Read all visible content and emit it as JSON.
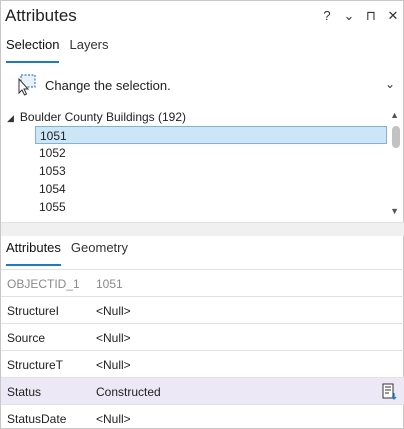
{
  "window": {
    "title": "Attributes",
    "controls": [
      "?",
      "⌄",
      "⊓",
      "✕"
    ]
  },
  "top_tabs": [
    {
      "label": "Selection",
      "active": true
    },
    {
      "label": "Layers",
      "active": false
    }
  ],
  "selection_action": {
    "icon": "selection-change-icon",
    "label": "Change the selection.",
    "chevron": "⌄"
  },
  "tree": {
    "layer_label": "Boulder County Buildings (192)",
    "items": [
      "1051",
      "1052",
      "1053",
      "1054",
      "1055"
    ],
    "selected_index": 0
  },
  "bottom_tabs": [
    {
      "label": "Attributes",
      "active": true
    },
    {
      "label": "Geometry",
      "active": false
    }
  ],
  "fields": [
    {
      "name": "OBJECTID_1",
      "value": "1051",
      "readonly": true
    },
    {
      "name": "StructureI",
      "value": "<Null>"
    },
    {
      "name": "Source",
      "value": "<Null>"
    },
    {
      "name": "StructureT",
      "value": "<Null>"
    },
    {
      "name": "Status",
      "value": "Constructed",
      "highlighted": true,
      "icon": "field-options-icon"
    },
    {
      "name": "StatusDate",
      "value": "<Null>"
    }
  ],
  "colors": {
    "accent": "#1f7ac4",
    "selected_row": "#cde6f7",
    "highlight_row": "#ece8f5"
  }
}
